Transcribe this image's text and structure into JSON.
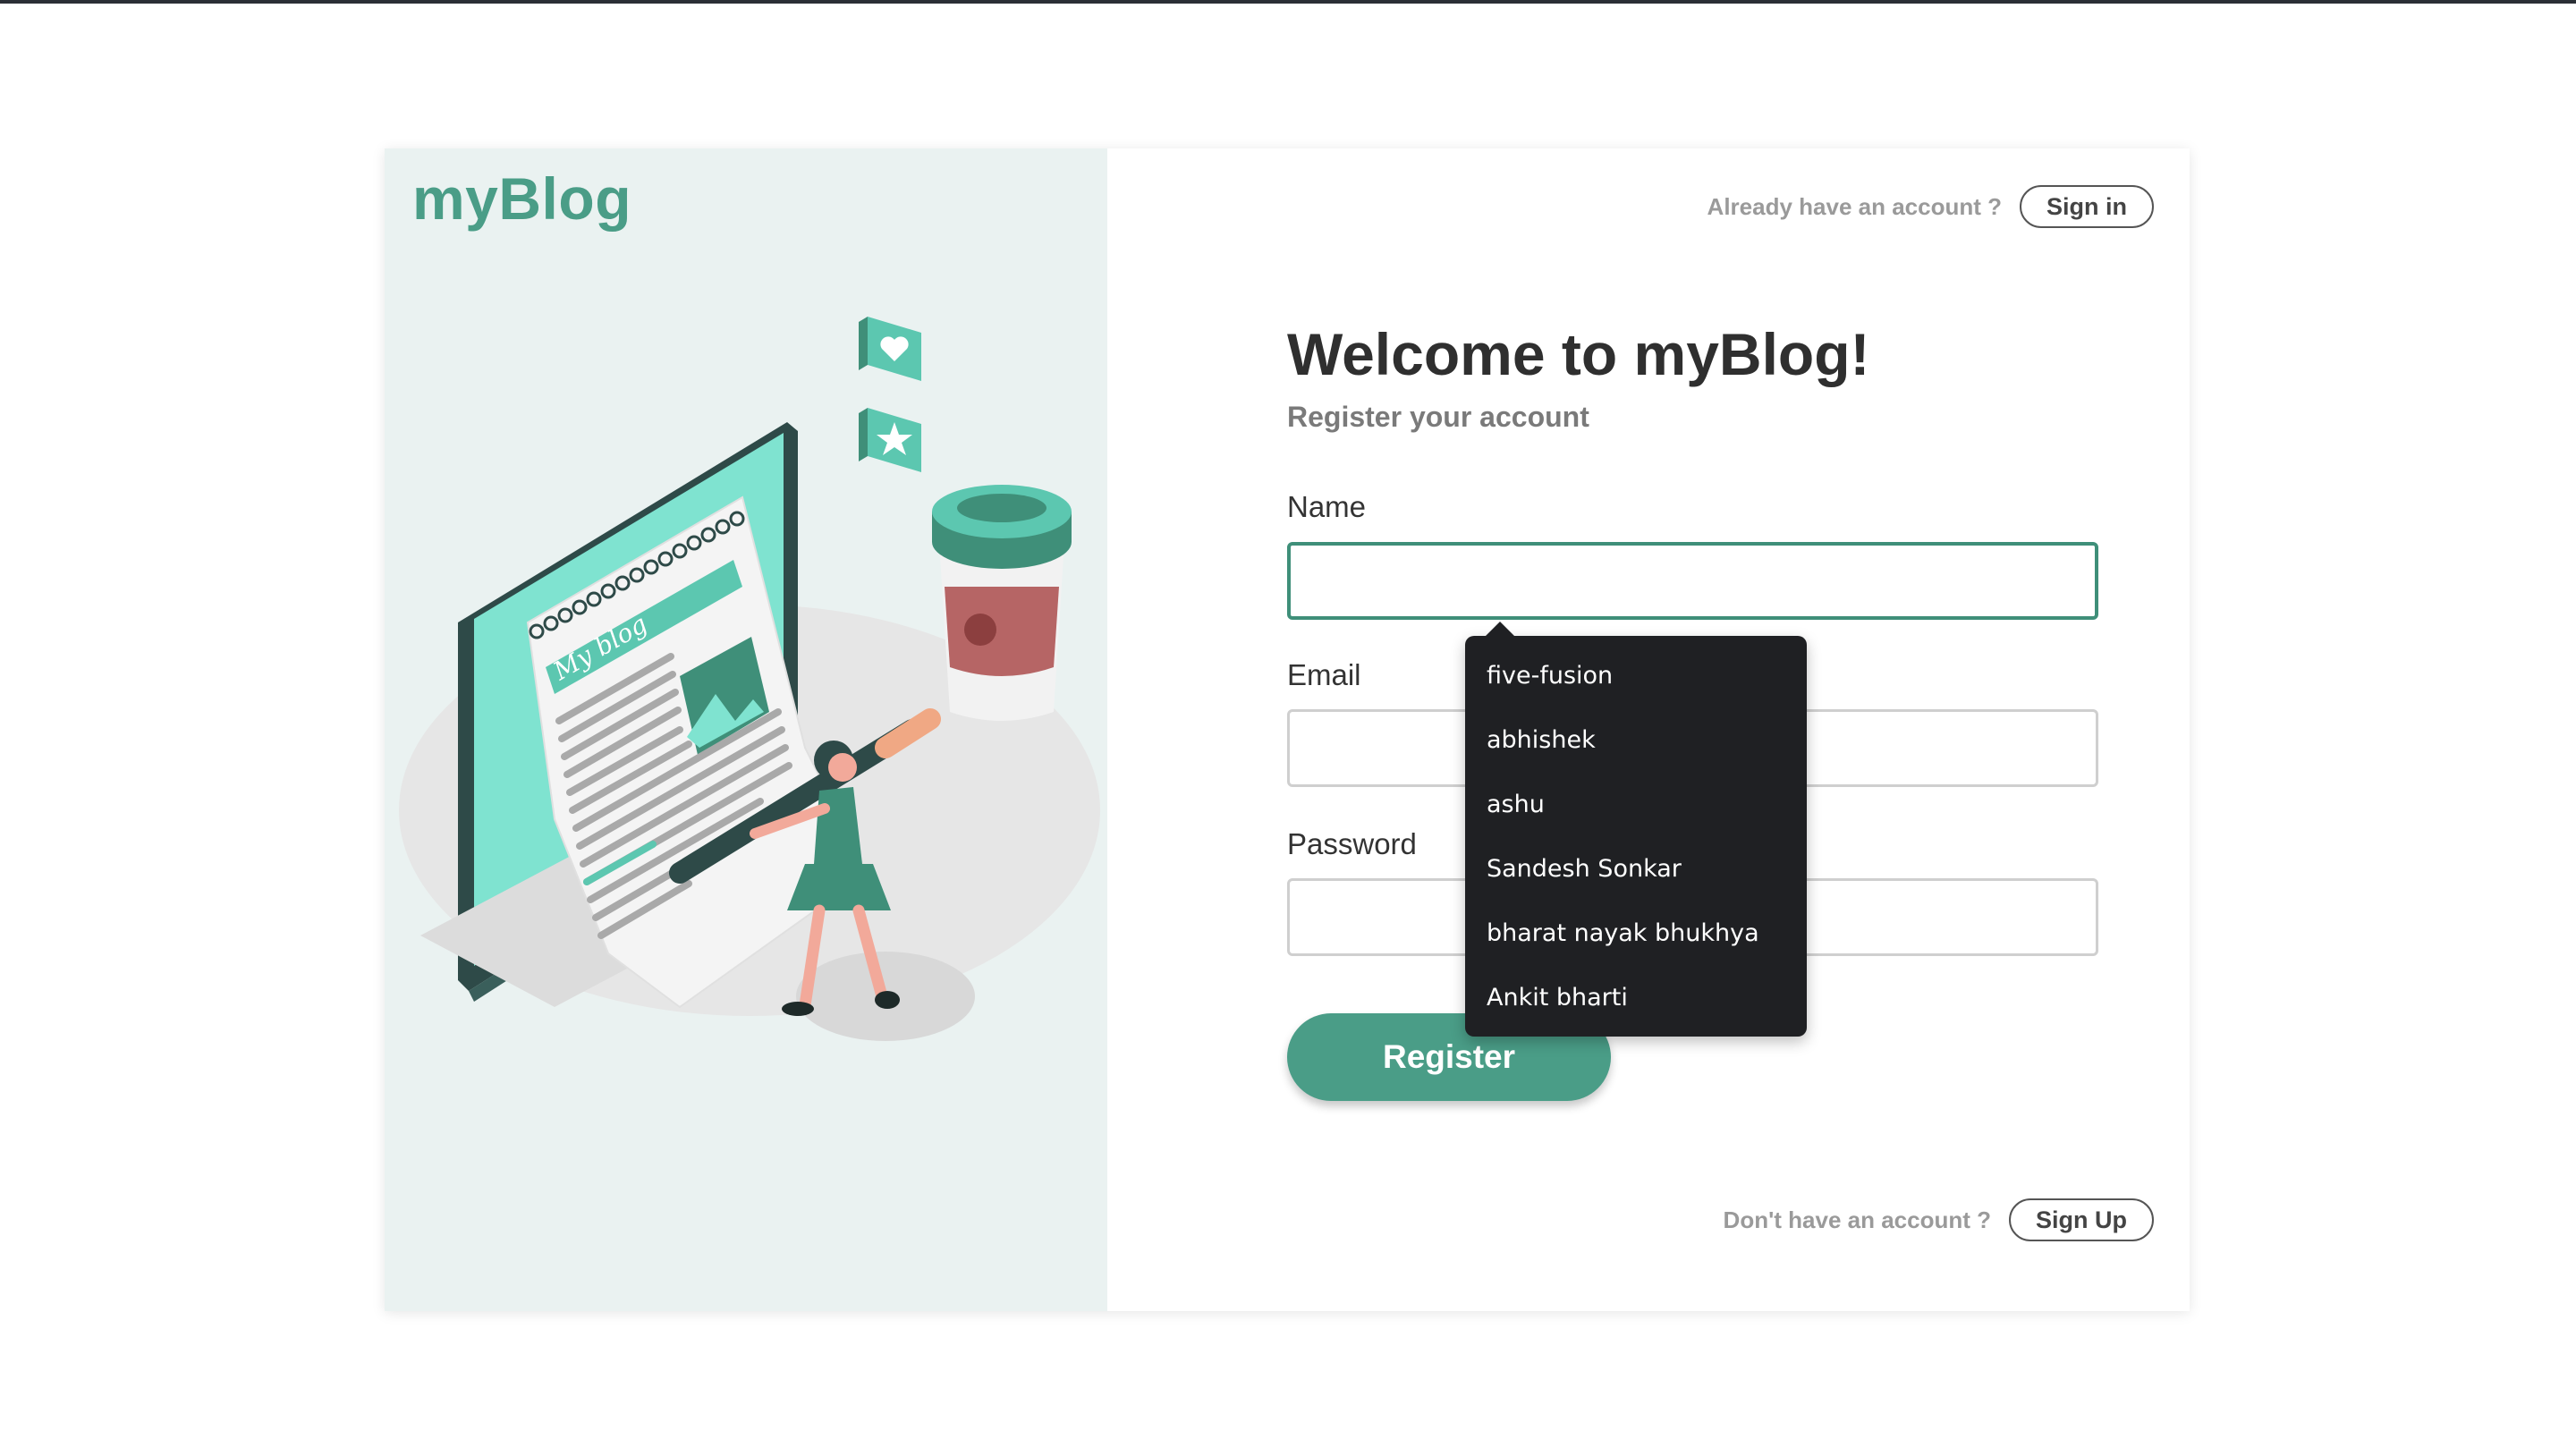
{
  "brand": {
    "logo": "myBlog",
    "illustration_text": "My blog"
  },
  "header": {
    "prompt": "Already have an account ?",
    "signin_label": "Sign in"
  },
  "form": {
    "title": "Welcome to myBlog!",
    "subtitle": "Register your account",
    "name_label": "Name",
    "name_value": "",
    "email_label": "Email",
    "email_value": "",
    "password_label": "Password",
    "password_value": "",
    "register_label": "Register"
  },
  "autocomplete": {
    "items": [
      "five-fusion",
      "abhishek",
      "ashu",
      "Sandesh Sonkar",
      "bharat nayak bhukhya",
      "Ankit bharti"
    ]
  },
  "footer": {
    "prompt": "Don't have an account ?",
    "signup_label": "Sign Up"
  },
  "colors": {
    "brand": "#4a9d87",
    "panel": "#eaf2f1",
    "teal": "#6fd6c2",
    "dark": "#2e4a48",
    "popup": "#1f2023"
  },
  "icons": [
    "heart-icon",
    "star-icon",
    "coffee-cup-icon"
  ]
}
